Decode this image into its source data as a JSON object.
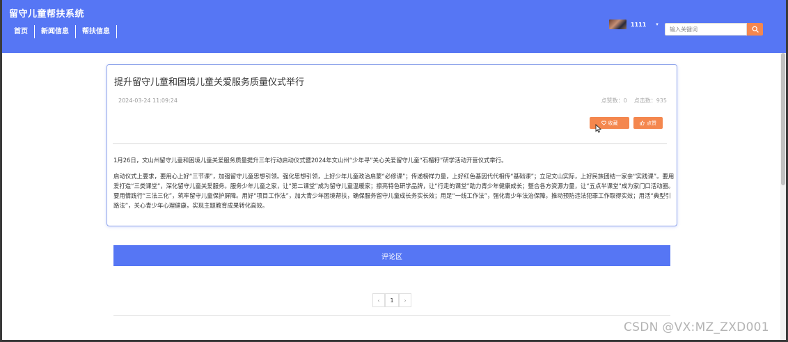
{
  "header": {
    "title": "留守儿童帮扶系统",
    "nav": [
      {
        "label": "首页"
      },
      {
        "label": "新闻信息"
      },
      {
        "label": "帮扶信息"
      }
    ],
    "username": "1111",
    "caret": "▾",
    "search": {
      "placeholder": "输入关键词",
      "icon": "search-icon"
    }
  },
  "article": {
    "title": "提升留守儿童和困境儿童关爱服务质量仪式举行",
    "date": "2024-03-24 11:09:24",
    "likes_label": "点赞数：0",
    "clicks_label": "点击数：935",
    "favorite_label": "收藏",
    "like_label": "点赞",
    "paragraphs": [
      "1月26日，文山州留守儿童和困境儿童关爱服务质量提升三年行动启动仪式暨2024年文山州“少年寻”关心关爱留守儿童“石榴籽”研学活动开营仪式举行。",
      "启动仪式上要求，要用心上好“三节课”，加强留守儿童思想引领。强化思想引领，上好少年儿童政治启蒙“必修课”；传递榜样力量，上好红色基因代代相传“基础课”；立足文山实际，上好民族团结一家亲“实践课”。要用爱打造“三类课堂”，深化留守儿童关爱服务。服务少年儿童之家，让“第二课堂”成为留守儿童温暖家；擦亮特色研学品牌，让“行走的课堂”助力青少年健康成长；整合各方资源力量，让“五点半课堂”成为家门口活动圈。要用情践行“三法三化”，筑牢留守儿童保护屏障。用好“项目工作法”，加大青少年困境帮扶，确保服务留守儿童成长务实长效；用足“一线工作法”，强化青少年法治保障，推动预防违法犯罪工作取得实效；用活“典型引路法”，关心青少年心理健康，实现主题教育成果转化高效。"
    ]
  },
  "comments": {
    "label": "评论区"
  },
  "pagination": {
    "prev": "‹",
    "current": "1",
    "next": "›"
  },
  "watermark": "CSDN @VX:MZ_ZXD001",
  "colors": {
    "primary": "#5676f4",
    "accent": "#f4874e"
  }
}
